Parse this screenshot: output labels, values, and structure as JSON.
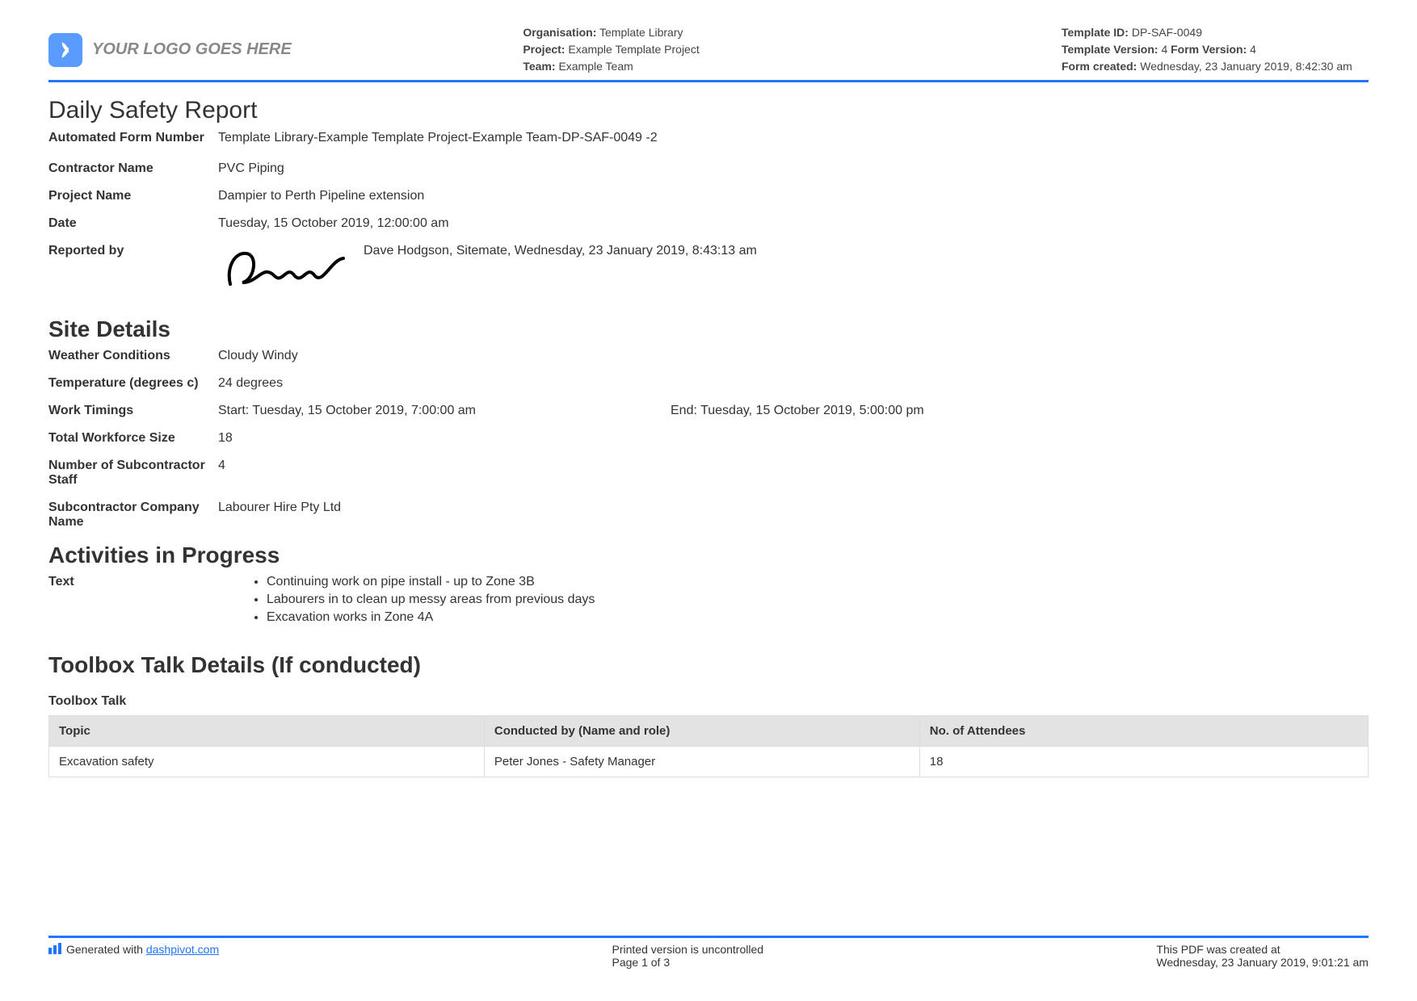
{
  "header": {
    "logo_text": "YOUR LOGO GOES HERE",
    "mid": {
      "org_label": "Organisation:",
      "org_value": "Template Library",
      "project_label": "Project:",
      "project_value": "Example Template Project",
      "team_label": "Team:",
      "team_value": "Example Team"
    },
    "right": {
      "template_id_label": "Template ID:",
      "template_id_value": "DP-SAF-0049",
      "template_version_label": "Template Version:",
      "template_version_value": "4",
      "form_version_label": "Form Version:",
      "form_version_value": "4",
      "form_created_label": "Form created:",
      "form_created_value": "Wednesday, 23 January 2019, 8:42:30 am"
    }
  },
  "title": "Daily Safety Report",
  "fields": {
    "afn_label": "Automated Form Number",
    "afn_value": "Template Library-Example Template Project-Example Team-DP-SAF-0049   -2",
    "contractor_label": "Contractor Name",
    "contractor_value": "PVC Piping",
    "project_label": "Project Name",
    "project_value": "Dampier to Perth Pipeline extension",
    "date_label": "Date",
    "date_value": "Tuesday, 15 October 2019, 12:00:00 am",
    "reported_label": "Reported by",
    "reported_value": "Dave Hodgson, Sitemate, Wednesday, 23 January 2019, 8:43:13 am"
  },
  "site_details": {
    "heading": "Site Details",
    "weather_label": "Weather Conditions",
    "weather_value": "Cloudy   Windy",
    "temp_label": "Temperature (degrees c)",
    "temp_value": "24 degrees",
    "timings_label": "Work Timings",
    "timings_start": "Start: Tuesday, 15 October 2019, 7:00:00 am",
    "timings_end": "End: Tuesday, 15 October 2019, 5:00:00 pm",
    "workforce_label": "Total Workforce Size",
    "workforce_value": "18",
    "sub_staff_label": "Number of Subcontractor Staff",
    "sub_staff_value": "4",
    "sub_company_label": "Subcontractor Company Name",
    "sub_company_value": "Labourer Hire Pty Ltd"
  },
  "activities": {
    "heading": "Activities in Progress",
    "text_label": "Text",
    "bullets": [
      "Continuing work on pipe install - up to Zone 3B",
      "Labourers in to clean up messy areas from previous days",
      "Excavation works in Zone 4A"
    ]
  },
  "toolbox": {
    "heading": "Toolbox Talk Details (If conducted)",
    "sub": "Toolbox Talk",
    "cols": [
      "Topic",
      "Conducted by (Name and role)",
      "No. of Attendees"
    ],
    "rows": [
      [
        "Excavation safety",
        "Peter Jones - Safety Manager",
        "18"
      ]
    ]
  },
  "footer": {
    "gen_prefix": "Generated with ",
    "gen_link": "dashpivot.com",
    "center_line1": "Printed version is uncontrolled",
    "center_line2": "Page 1 of 3",
    "right_line1": "This PDF was created at",
    "right_line2": "Wednesday, 23 January 2019, 9:01:21 am"
  }
}
